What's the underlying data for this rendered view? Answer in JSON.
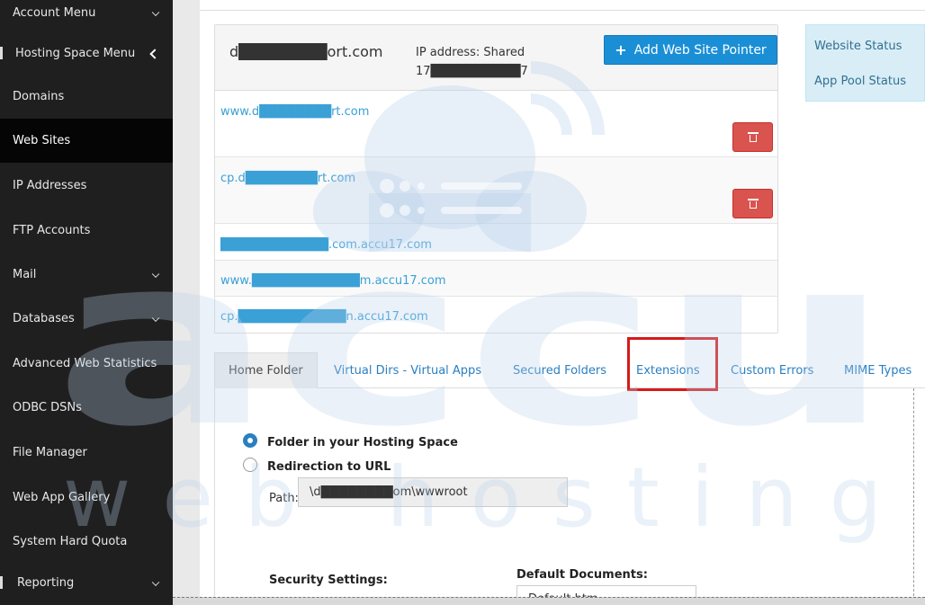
{
  "sidebar": {
    "items": [
      {
        "label": "Account Menu",
        "type": "expand"
      },
      {
        "label": "Hosting Space Menu",
        "type": "collapse"
      },
      {
        "label": "Domains",
        "type": "plain"
      },
      {
        "label": "Web Sites",
        "type": "active"
      },
      {
        "label": "IP Addresses",
        "type": "plain"
      },
      {
        "label": "FTP Accounts",
        "type": "plain"
      },
      {
        "label": "Mail",
        "type": "expand"
      },
      {
        "label": "Databases",
        "type": "expand"
      },
      {
        "label": "Advanced Web Statistics",
        "type": "plain"
      },
      {
        "label": "ODBC DSNs",
        "type": "plain"
      },
      {
        "label": "File Manager",
        "type": "plain"
      },
      {
        "label": "Web App Gallery",
        "type": "plain"
      },
      {
        "label": "System Hard Quota",
        "type": "plain"
      },
      {
        "label": "Reporting",
        "type": "expand"
      }
    ]
  },
  "site": {
    "domain": "d████████ort.com",
    "ip_label": "IP address: Shared",
    "ip_value": "17██████████7",
    "add_pointer_label": "Add Web Site Pointer"
  },
  "pointers": [
    {
      "text": "www.d████████rt.com",
      "deletable": true
    },
    {
      "text": "cp.d████████rt.com",
      "deletable": true
    },
    {
      "text": "████████████.com.accu17.com",
      "deletable": false
    },
    {
      "text": "www.████████████m.accu17.com",
      "deletable": false
    },
    {
      "text": "cp.████████████n.accu17.com",
      "deletable": false
    }
  ],
  "status_links": {
    "website_status": "Website Status",
    "app_pool_status": "App Pool Status"
  },
  "tabs": [
    {
      "label": "Home Folder"
    },
    {
      "label": "Virtual Dirs - Virtual Apps"
    },
    {
      "label": "Secured Folders"
    },
    {
      "label": "Extensions"
    },
    {
      "label": "Custom Errors"
    },
    {
      "label": "MIME Types"
    }
  ],
  "home_folder": {
    "option_folder": "Folder in your Hosting Space",
    "option_redirect": "Redirection to URL",
    "path_label": "Path:",
    "path_value": "\\d████████om\\wwwroot",
    "security_settings_label": "Security Settings:",
    "default_documents_label": "Default Documents:",
    "default_document_value": "Default.htm"
  },
  "watermark": {
    "brand_big": "accu",
    "brand_small": "web hosting"
  },
  "colors": {
    "sidebar_bg": "#1f1f1f",
    "accent": "#1a8fd6",
    "link": "#3aa0d6",
    "danger": "#d9534f",
    "highlight": "#d71a1a"
  }
}
